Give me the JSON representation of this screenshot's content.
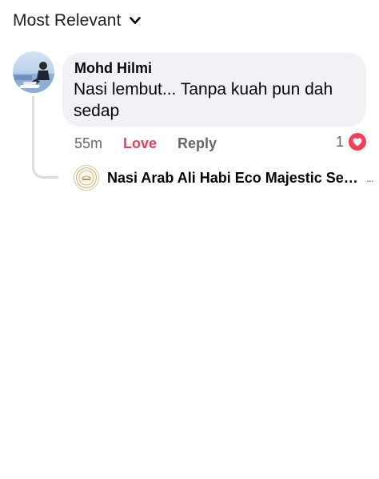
{
  "sort": {
    "label": "Most Relevant",
    "icon": "chevron-down-icon"
  },
  "comment": {
    "author": "Mohd Hilmi",
    "text": "Nasi lembut... Tanpa kuah pun dah sedap",
    "time": "55m",
    "love_label": "Love",
    "reply_label": "Reply",
    "reaction_count": "1",
    "reaction_icon": "heart-icon",
    "colors": {
      "love": "#e4405f",
      "heart_badge": "#f33e58",
      "bubble": "#f0f2f5"
    }
  },
  "reply": {
    "author": "Nasi Arab Ali Habi Eco Majestic Sem...",
    "more": "..."
  }
}
